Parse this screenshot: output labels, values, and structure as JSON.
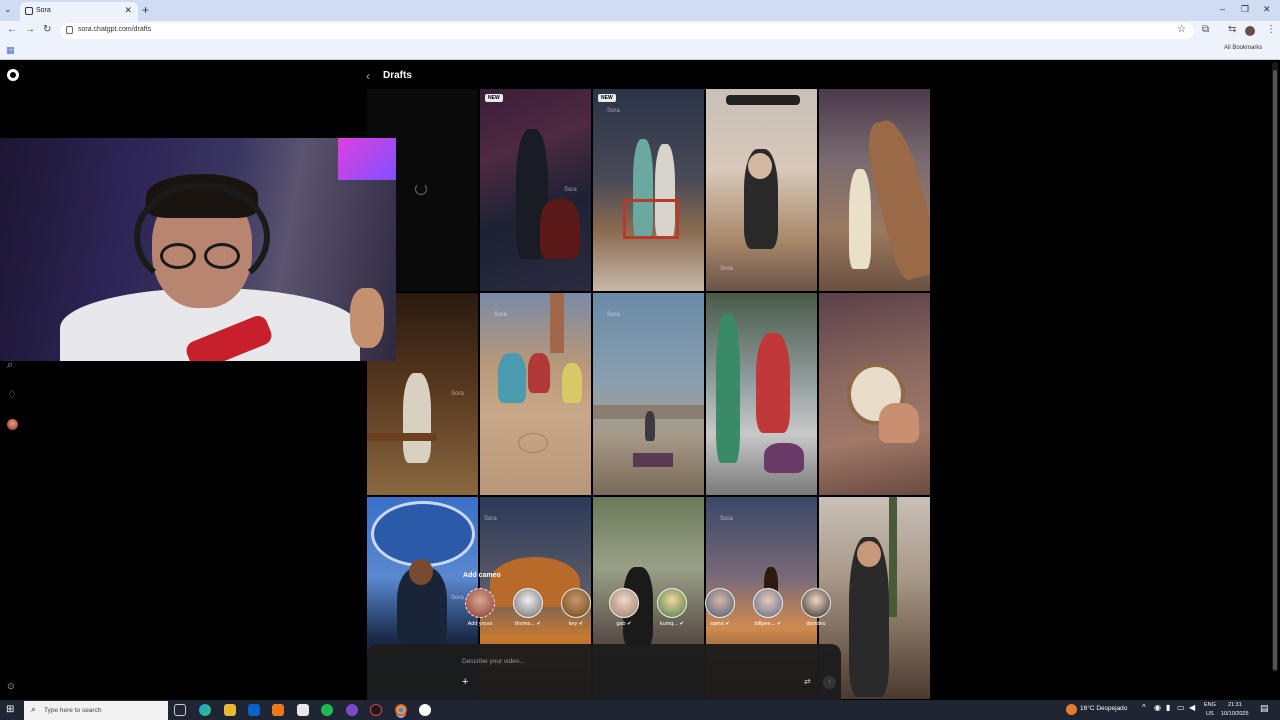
{
  "browser": {
    "tab_title": "Sora",
    "url": "sora.chatgpt.com/drafts",
    "all_bookmarks": "All Bookmarks"
  },
  "page": {
    "title": "Drafts",
    "new_badge": "NEW",
    "watermark": "Sora"
  },
  "cameo": {
    "label": "Add cameo",
    "items": [
      {
        "name": "Add yours"
      },
      {
        "name": "thoma..."
      },
      {
        "name": "key"
      },
      {
        "name": "gab"
      },
      {
        "name": "kumq..."
      },
      {
        "name": "sama"
      },
      {
        "name": "billpee..."
      },
      {
        "name": "davideu"
      }
    ]
  },
  "composer": {
    "placeholder": "Describe your video..."
  },
  "taskbar": {
    "search_placeholder": "Type here to search",
    "weather": "16°C  Despejado",
    "lang_top": "ENG",
    "lang_bottom": "US",
    "time": "21:31",
    "date": "10/10/2025"
  }
}
